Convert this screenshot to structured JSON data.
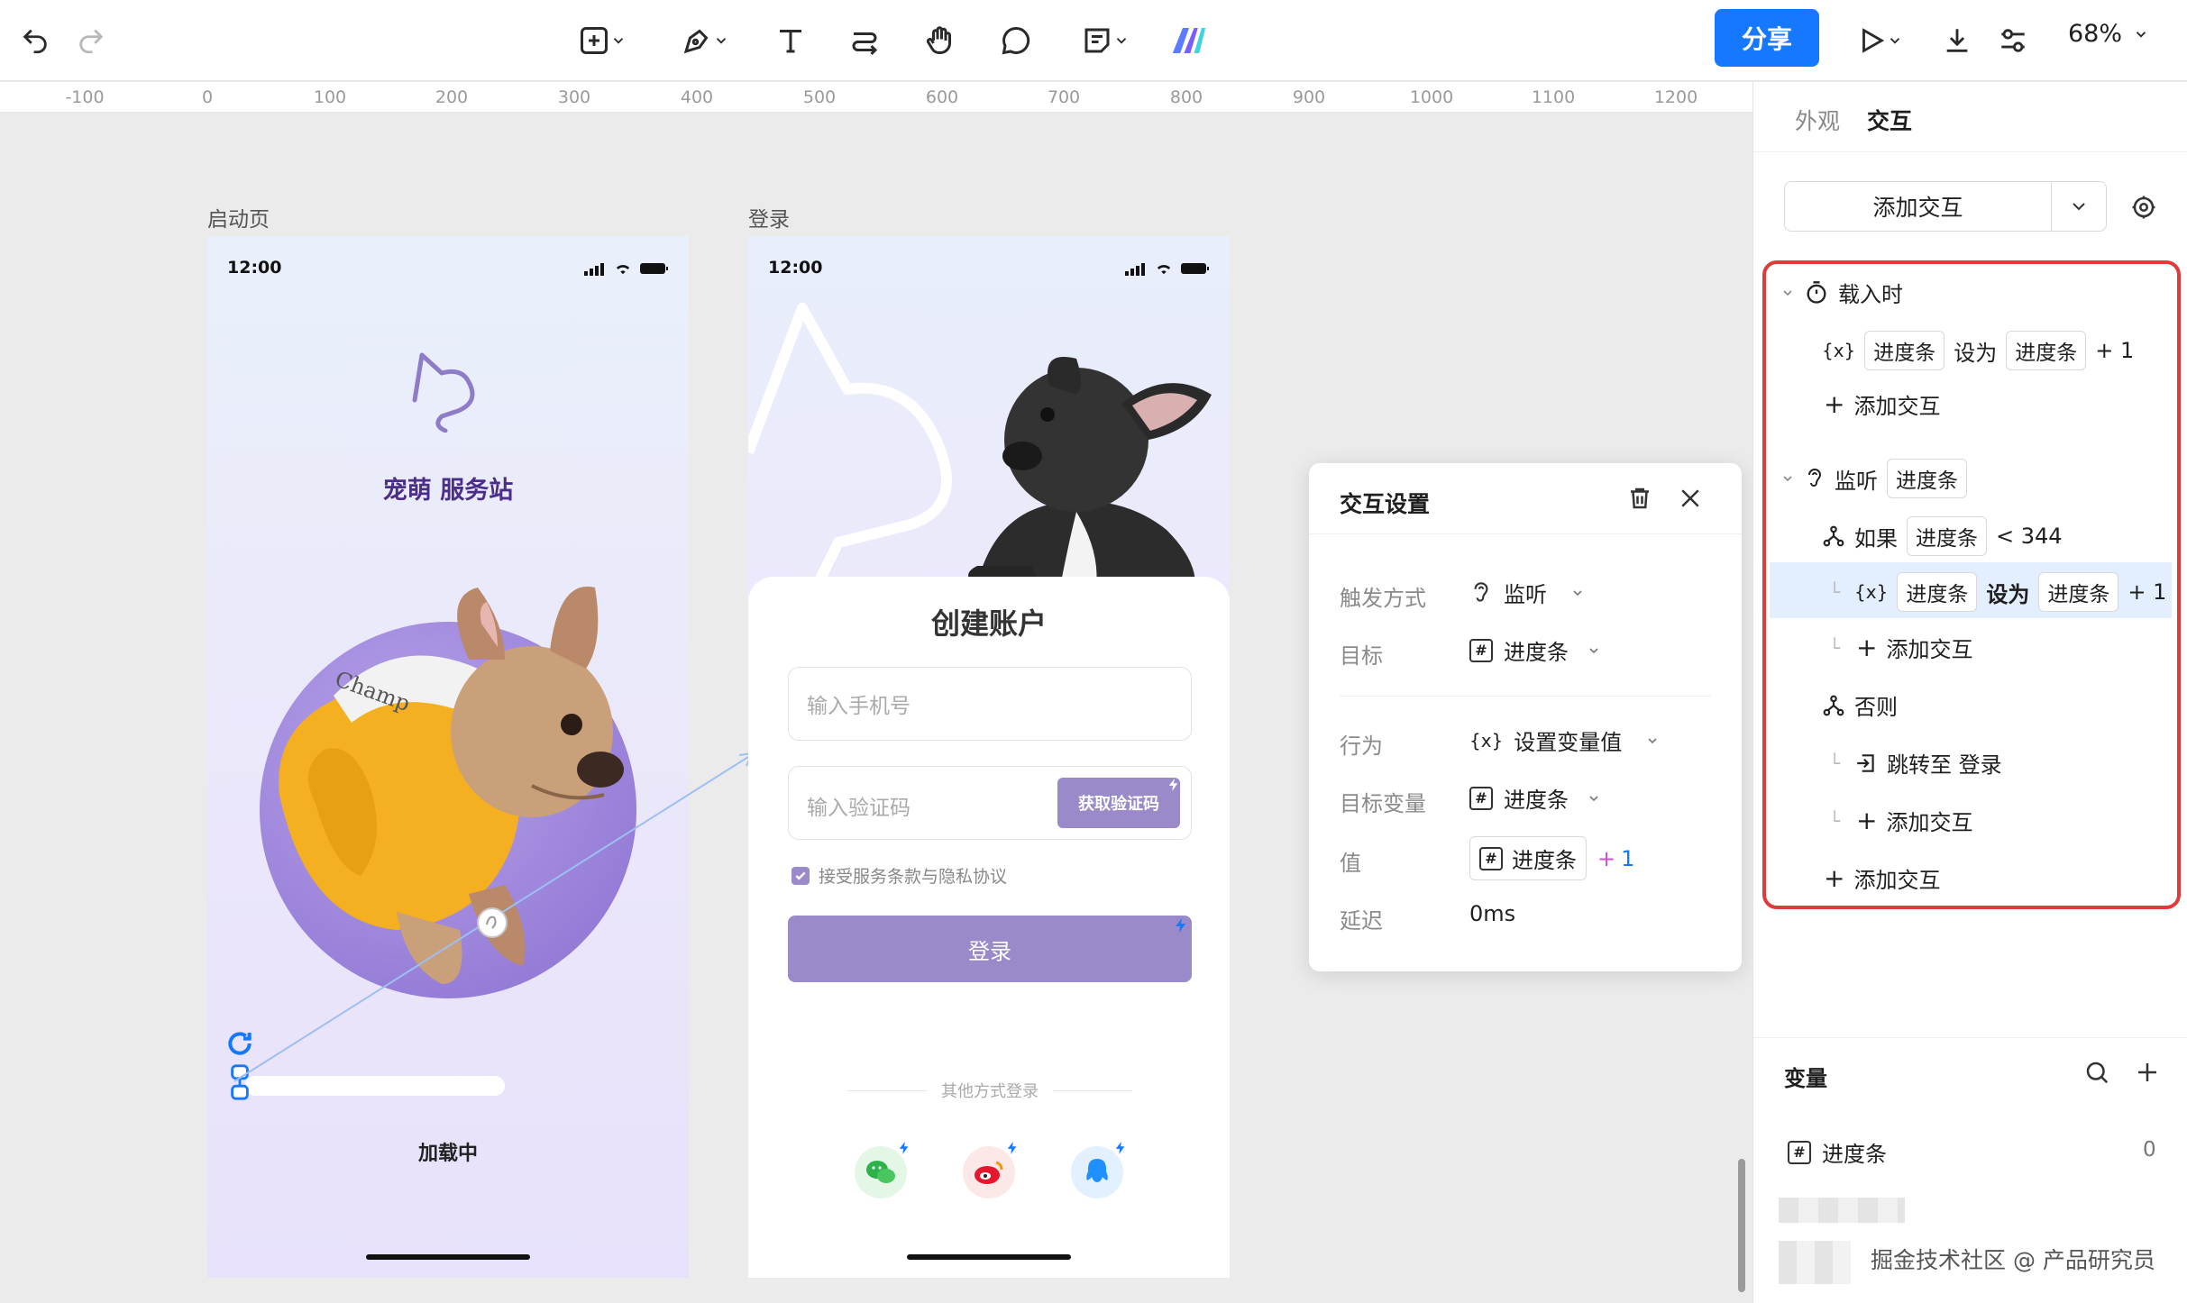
{
  "toolbar": {
    "share_label": "分享",
    "zoom_level": "68%"
  },
  "ruler": {
    "ticks": [
      "-100",
      "0",
      "100",
      "200",
      "300",
      "400",
      "500",
      "600",
      "700",
      "800",
      "900",
      "1000",
      "1100",
      "1200"
    ]
  },
  "canvas": {
    "frame1": {
      "label": "启动页",
      "time": "12:00",
      "brand": "宠萌 服务站",
      "loading": "加载中"
    },
    "frame2": {
      "label": "登录",
      "time": "12:00",
      "title": "创建账户",
      "phone_placeholder": "输入手机号",
      "code_placeholder": "输入验证码",
      "get_code": "获取验证码",
      "agree": "接受服务条款与隐私协议",
      "login": "登录",
      "other_login": "其他方式登录"
    }
  },
  "popup": {
    "title": "交互设置",
    "trigger_label": "触发方式",
    "trigger_value": "监听",
    "target_label": "目标",
    "target_value": "进度条",
    "action_label": "行为",
    "action_value": "设置变量值",
    "target_var_label": "目标变量",
    "target_var_value": "进度条",
    "value_label": "值",
    "value_chip": "进度条",
    "value_plus": "+",
    "value_num": "1",
    "delay_label": "延迟",
    "delay_value": "0ms"
  },
  "panel": {
    "tab_appearance": "外观",
    "tab_interaction": "交互",
    "add_interaction": "添加交互",
    "on_load": "载入时",
    "var_chip": "进度条",
    "set_to": "设为",
    "plus_one": "+ 1",
    "add": "添加交互",
    "listen": "监听",
    "if": "如果",
    "lt_344": "< 344",
    "else": "否则",
    "jump": "跳转至 登录",
    "variables_title": "变量",
    "var_name": "进度条",
    "var_value": "0",
    "watermark": "掘金技术社区 @ 产品研究员"
  },
  "colors": {
    "accent": "#1677ff",
    "purple": "#9b8ac9",
    "highlight_red": "#e03a3a"
  }
}
